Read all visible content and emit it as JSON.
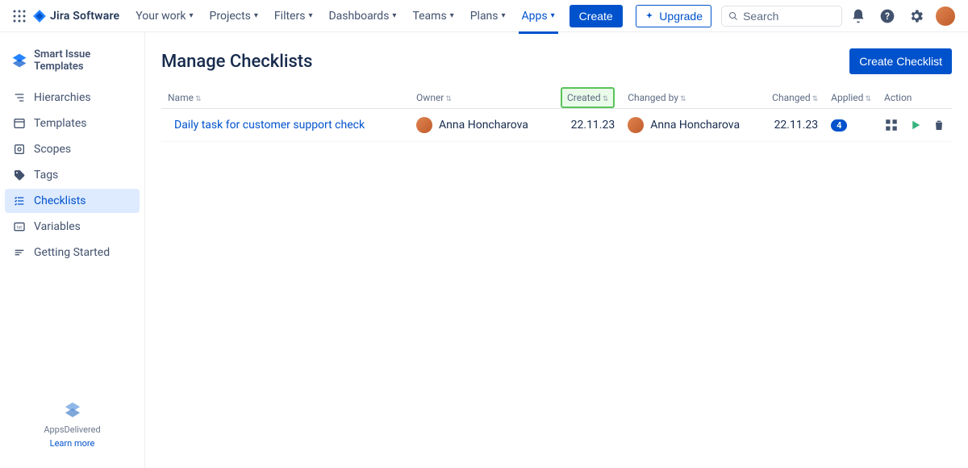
{
  "topnav": {
    "logo_text": "Jira Software",
    "items": [
      {
        "label": "Your work"
      },
      {
        "label": "Projects"
      },
      {
        "label": "Filters"
      },
      {
        "label": "Dashboards"
      },
      {
        "label": "Teams"
      },
      {
        "label": "Plans"
      },
      {
        "label": "Apps"
      }
    ],
    "create_label": "Create",
    "upgrade_label": "Upgrade",
    "search_placeholder": "Search"
  },
  "sidebar": {
    "app_name": "Smart Issue Templates",
    "items": [
      {
        "label": "Hierarchies"
      },
      {
        "label": "Templates"
      },
      {
        "label": "Scopes"
      },
      {
        "label": "Tags"
      },
      {
        "label": "Checklists"
      },
      {
        "label": "Variables"
      },
      {
        "label": "Getting Started"
      }
    ],
    "footer_brand": "AppsDelivered",
    "footer_learn": "Learn more"
  },
  "main": {
    "title": "Manage Checklists",
    "create_button": "Create Checklist",
    "columns": {
      "name": "Name",
      "owner": "Owner",
      "created": "Created",
      "changed_by": "Changed by",
      "changed": "Changed",
      "applied": "Applied",
      "action": "Action"
    },
    "rows": [
      {
        "name": "Daily task for customer support check",
        "owner": "Anna Honcharova",
        "created": "22.11.23",
        "changed_by": "Anna Honcharova",
        "changed": "22.11.23",
        "applied": "4"
      }
    ]
  }
}
